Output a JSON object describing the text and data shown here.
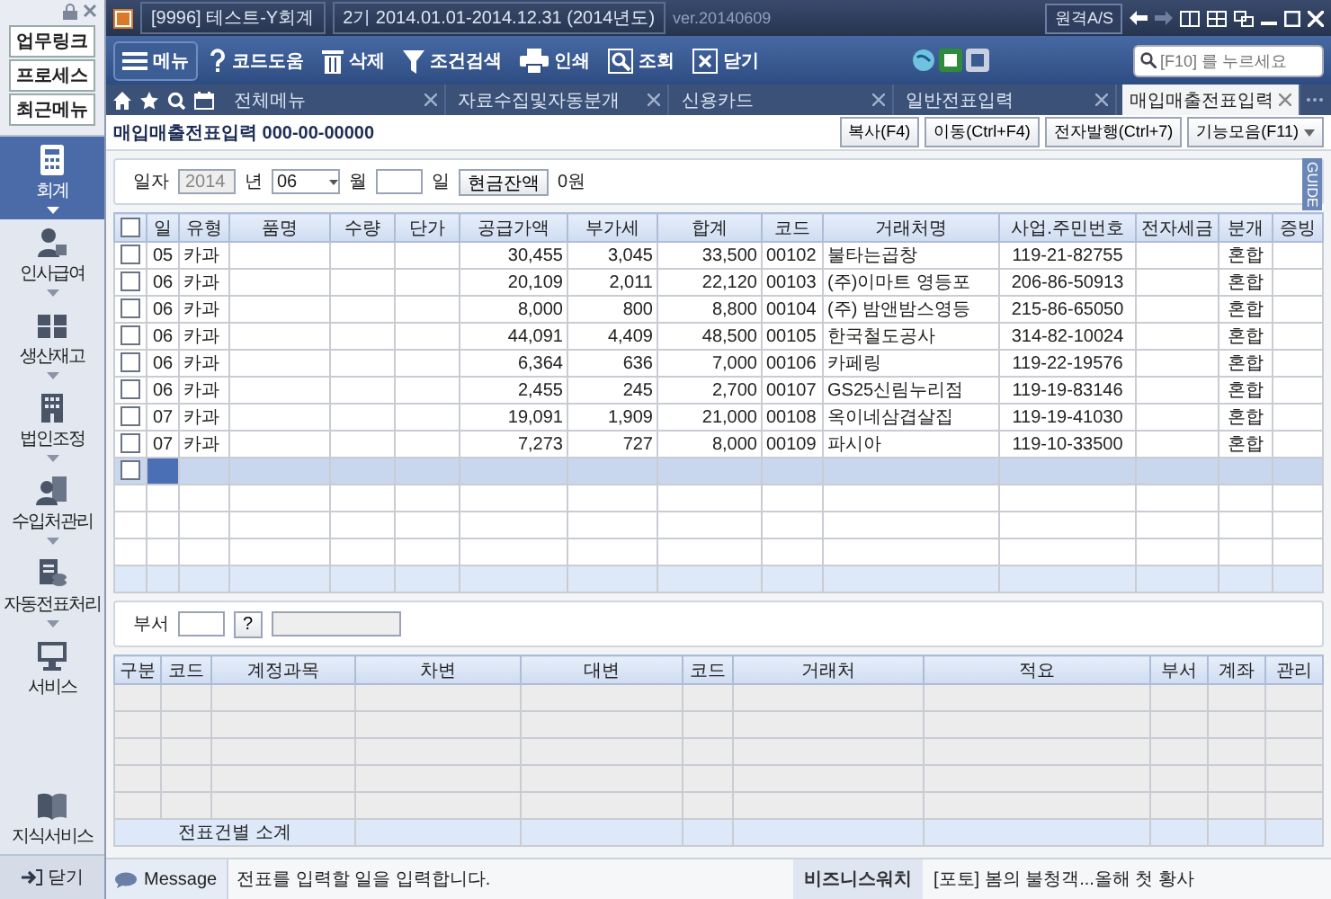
{
  "title_bar": {
    "company": "[9996] 테스트-Y회계",
    "period": "2기 2014.01.01-2014.12.31 (2014년도)",
    "version": "ver.20140609",
    "remote_button": "원격A/S"
  },
  "quick_links": [
    "업무링크",
    "프로세스",
    "최근메뉴"
  ],
  "sidebar": {
    "items": [
      {
        "label": "회계",
        "selected": true
      },
      {
        "label": "인사급여",
        "selected": false
      },
      {
        "label": "생산재고",
        "selected": false
      },
      {
        "label": "법인조정",
        "selected": false
      },
      {
        "label": "수입처관리",
        "selected": false
      },
      {
        "label": "자동전표처리",
        "selected": false
      },
      {
        "label": "서비스",
        "selected": false
      },
      {
        "label": "지식서비스",
        "selected": false
      }
    ],
    "close": "닫기"
  },
  "toolbar": {
    "buttons": [
      "메뉴",
      "코드도움",
      "삭제",
      "조건검색",
      "인쇄",
      "조회",
      "닫기"
    ],
    "search": {
      "placeholder": "[F10] 를 누르세요"
    }
  },
  "tabs": [
    {
      "label": "전체메뉴",
      "selected": false
    },
    {
      "label": "자료수집및자동분개",
      "selected": false
    },
    {
      "label": "신용카드",
      "selected": false
    },
    {
      "label": "일반전표입력",
      "selected": false
    },
    {
      "label": "매입매출전표입력",
      "selected": true
    }
  ],
  "page": {
    "title": "매입매출전표입력",
    "biz_no": "000-00-00000",
    "actions": [
      {
        "label": "복사(F4)",
        "dropdown": false
      },
      {
        "label": "이동(Ctrl+F4)",
        "dropdown": false
      },
      {
        "label": "전자발행(Ctrl+7)",
        "dropdown": false
      },
      {
        "label": "기능모음(F11)",
        "dropdown": true
      }
    ]
  },
  "filter": {
    "label": "일자",
    "year": "2014",
    "year_unit": "년",
    "month": "06",
    "month_unit": "월",
    "day_unit": "일",
    "cash_button": "현금잔액",
    "cash_amount": "0원",
    "guide_tab": "GUIDE"
  },
  "sales_table": {
    "all_checked": false,
    "columns": [
      "일",
      "유형",
      "품명",
      "수량",
      "단가",
      "공급가액",
      "부가세",
      "합계",
      "코드",
      "거래처명",
      "사업.주민번호",
      "전자세금",
      "분개",
      "증빙"
    ],
    "rows": [
      {
        "checked": false,
        "selected": false,
        "day": "05",
        "type": "카과",
        "supply": "30,455",
        "vat": "3,045",
        "total": "33,500",
        "code": "00102",
        "partner": "불타는곱창",
        "reg_no": "119-21-82755",
        "entry": "혼합"
      },
      {
        "checked": false,
        "selected": false,
        "day": "06",
        "type": "카과",
        "supply": "20,109",
        "vat": "2,011",
        "total": "22,120",
        "code": "00103",
        "partner": "(주)이마트 영등포",
        "reg_no": "206-86-50913",
        "entry": "혼합"
      },
      {
        "checked": false,
        "selected": false,
        "day": "06",
        "type": "카과",
        "supply": "8,000",
        "vat": "800",
        "total": "8,800",
        "code": "00104",
        "partner": "(주) 밤앤밤스영등",
        "reg_no": "215-86-65050",
        "entry": "혼합"
      },
      {
        "checked": false,
        "selected": false,
        "day": "06",
        "type": "카과",
        "supply": "44,091",
        "vat": "4,409",
        "total": "48,500",
        "code": "00105",
        "partner": "한국철도공사",
        "reg_no": "314-82-10024",
        "entry": "혼합"
      },
      {
        "checked": false,
        "selected": false,
        "day": "06",
        "type": "카과",
        "supply": "6,364",
        "vat": "636",
        "total": "7,000",
        "code": "00106",
        "partner": "카페링",
        "reg_no": "119-22-19576",
        "entry": "혼합"
      },
      {
        "checked": false,
        "selected": false,
        "day": "06",
        "type": "카과",
        "supply": "2,455",
        "vat": "245",
        "total": "2,700",
        "code": "00107",
        "partner": "GS25신림누리점",
        "reg_no": "119-19-83146",
        "entry": "혼합"
      },
      {
        "checked": false,
        "selected": false,
        "day": "07",
        "type": "카과",
        "supply": "19,091",
        "vat": "1,909",
        "total": "21,000",
        "code": "00108",
        "partner": "옥이네삼겹살집",
        "reg_no": "119-19-41030",
        "entry": "혼합"
      },
      {
        "checked": false,
        "selected": false,
        "day": "07",
        "type": "카과",
        "supply": "7,273",
        "vat": "727",
        "total": "8,000",
        "code": "00109",
        "partner": "파시아",
        "reg_no": "119-10-33500",
        "entry": "혼합"
      }
    ],
    "new_row": {
      "checked": false,
      "selected": true
    }
  },
  "department": {
    "label": "부서",
    "help": "?"
  },
  "journal_table": {
    "columns": [
      "구분",
      "코드",
      "계정과목",
      "차변",
      "대변",
      "코드",
      "거래처",
      "적요",
      "부서",
      "계좌",
      "관리"
    ],
    "subtotal_label": "전표건별 소계"
  },
  "status_bar": {
    "message_label": "Message",
    "message": "전표를 입력할 일을 입력합니다.",
    "news_label": "비즈니스워치",
    "news": "[포토] 봄의 불청객...올해 첫 황사"
  }
}
